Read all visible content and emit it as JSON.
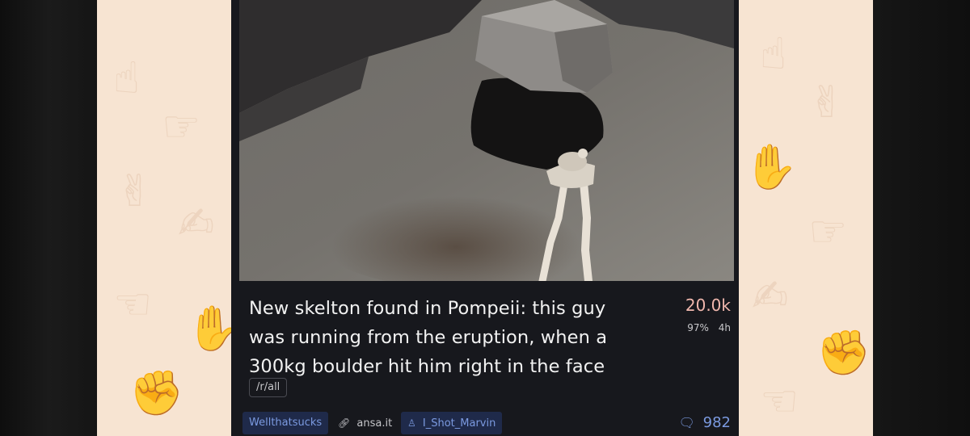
{
  "post": {
    "title": "New skelton found in Pompeii: this guy was running from the eruption, when a 300kg boulder hit him right in the face",
    "score": "20.0k",
    "upvote_ratio": "97%",
    "age": "4h",
    "flair": "/r/all",
    "subreddit": "Wellthatsucks",
    "domain": "ansa.it",
    "author": "I_Shot_Marvin",
    "comment_count": "982",
    "image_icon": "photo-skeleton-boulder"
  },
  "icons": {
    "link": "link-icon",
    "user": "user-icon",
    "comment": "comment-bubble-icon",
    "wallpaper": "hand-doodle-icon"
  },
  "colors": {
    "card_bg": "#17181d",
    "wallpaper": "#f7e4d2",
    "score": "#f0b7ad",
    "chip_bg": "#1f2a4a",
    "chip_text": "#7b9ae0"
  }
}
